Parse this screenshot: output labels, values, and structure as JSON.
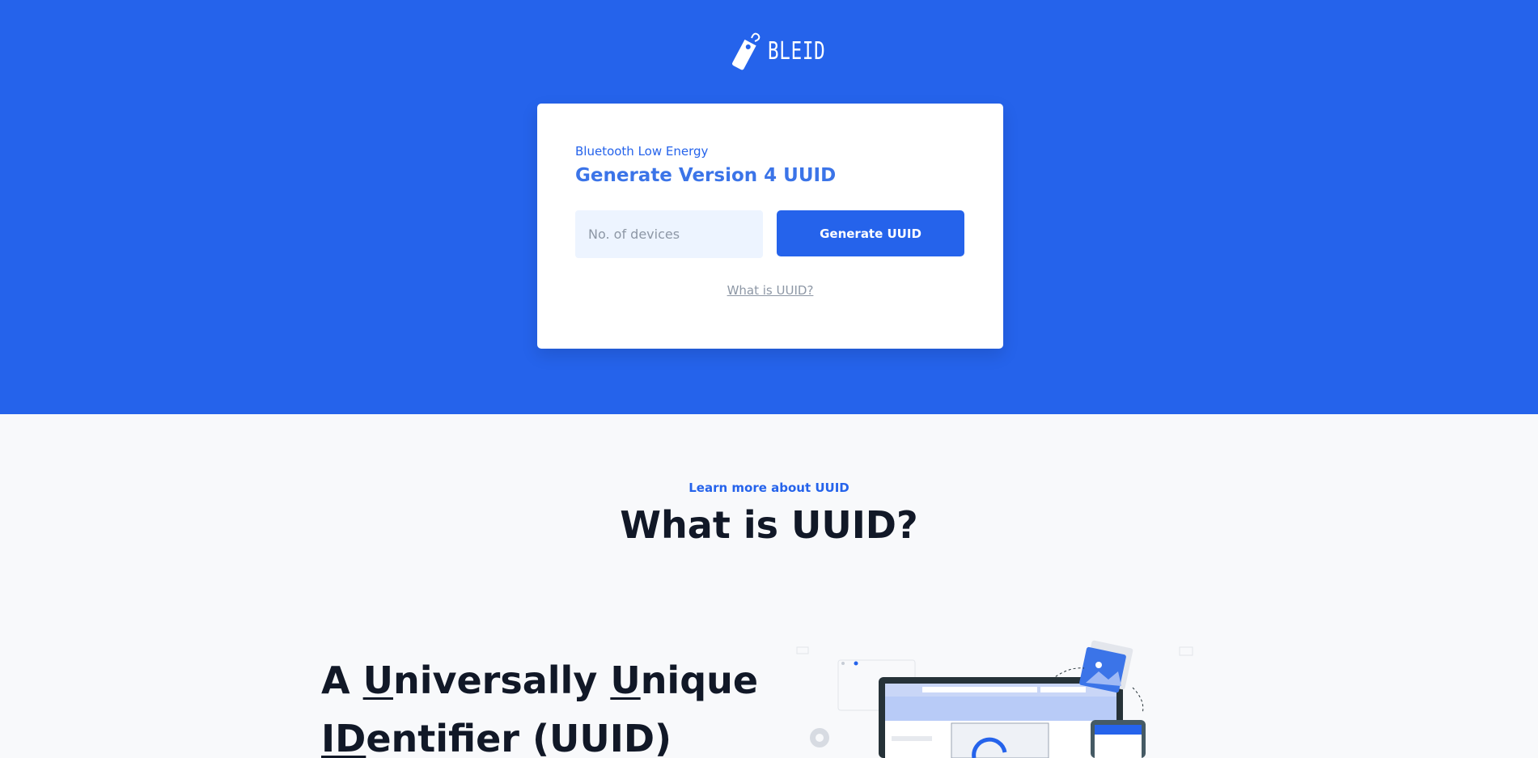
{
  "brand": {
    "name": "BLEID"
  },
  "generator": {
    "subtitle": "Bluetooth Low Energy",
    "title": "Generate Version 4 UUID",
    "devices_placeholder": "No. of devices",
    "button_label": "Generate UUID",
    "help_link": "What is UUID?"
  },
  "about": {
    "eyebrow": "Learn more about UUID",
    "title": "What is UUID?",
    "heading_parts": [
      "A ",
      "U",
      "niversally ",
      "U",
      "nique",
      "ID",
      "entifier (UUID)"
    ]
  },
  "colors": {
    "primary": "#2563eb",
    "background": "#f8f9fb",
    "text": "#111827"
  },
  "icons": {
    "logo": "tag-icon",
    "illustration": "devices-sync-illustration"
  }
}
